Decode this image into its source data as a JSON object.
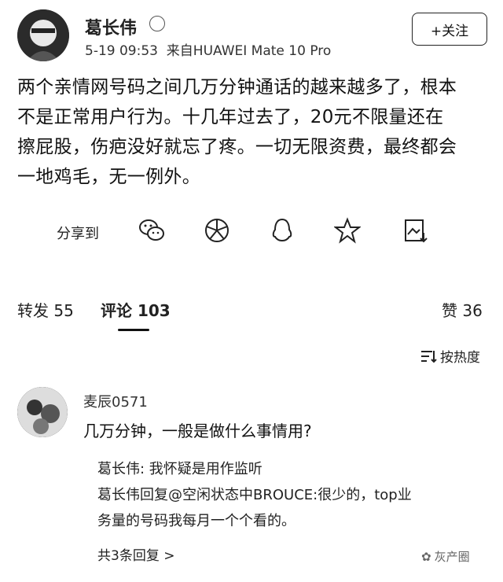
{
  "post": {
    "author": "葛长伟",
    "meta": "5-19 09:53  来自HUAWEI Mate 10 Pro",
    "follow_label": "+关注",
    "lines": [
      "两个亲情网号码之间几万分钟通话的越来越多了，根本",
      "不是正常用户行为。十几年过去了，20元不限量还在",
      "擦屁股，伤疤没好就忘了疼。一切无限资费，最终都会",
      "一地鸡毛，无一例外。"
    ]
  },
  "share": {
    "label": "分享到",
    "icons": [
      "wechat-icon",
      "moments-icon",
      "qq-icon",
      "qzone-star-icon",
      "save-image-icon"
    ]
  },
  "tabs": {
    "repost": "转发 55",
    "comments": "评论 103",
    "likes": "赞 36"
  },
  "sort_label": "按热度",
  "comment": {
    "author": "麦辰0571",
    "text": "几万分钟，一般是做什么事情用?",
    "replies": [
      "葛长伟: 我怀疑是用作监听",
      "葛长伟回复@空闲状态中BROUCE:很少的，top业",
      "务量的号码我每月一个个看的。"
    ],
    "more": "共3条回复 >"
  },
  "watermark": "灰产圈"
}
